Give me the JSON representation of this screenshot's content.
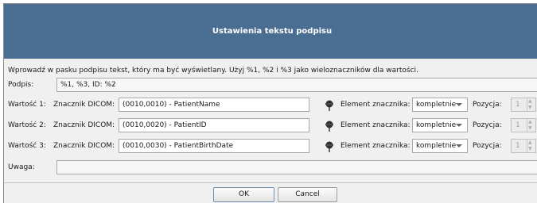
{
  "dialog": {
    "title": "Ustawienia tekstu podpisu",
    "instruction": "Wprowadź w pasku podpisu tekst, który ma być wyświetlany. Użyj %1, %2 i %3 jako wieloznaczników dla wartości.",
    "caption_label": "Podpis:",
    "caption_value": "%1, %3, ID: %2",
    "values": [
      {
        "label": "Wartość 1:",
        "tag_label": "Znacznik DICOM:",
        "tag_value": "(0010,0010) - PatientName",
        "element_label": "Element znacznika:",
        "element_value": "kompletnie",
        "position_label": "Pozycja:",
        "position_value": "1"
      },
      {
        "label": "Wartość 2:",
        "tag_label": "Znacznik DICOM:",
        "tag_value": "(0010,0020) - PatientID",
        "element_label": "Element znacznika:",
        "element_value": "kompletnie",
        "position_label": "Pozycja:",
        "position_value": "1"
      },
      {
        "label": "Wartość 3:",
        "tag_label": "Znacznik DICOM:",
        "tag_value": "(0010,0030) - PatientBirthDate",
        "element_label": "Element znacznika:",
        "element_value": "kompletnie",
        "position_label": "Pozycja:",
        "position_value": "1"
      }
    ],
    "note_label": "Uwaga:",
    "note_value": "",
    "ok_label": "OK",
    "cancel_label": "Cancel"
  },
  "colors": {
    "titlebar": "#4a6e92",
    "background": "#f0f0f0"
  },
  "icons": {
    "tag_picker": "pushpin-icon"
  }
}
